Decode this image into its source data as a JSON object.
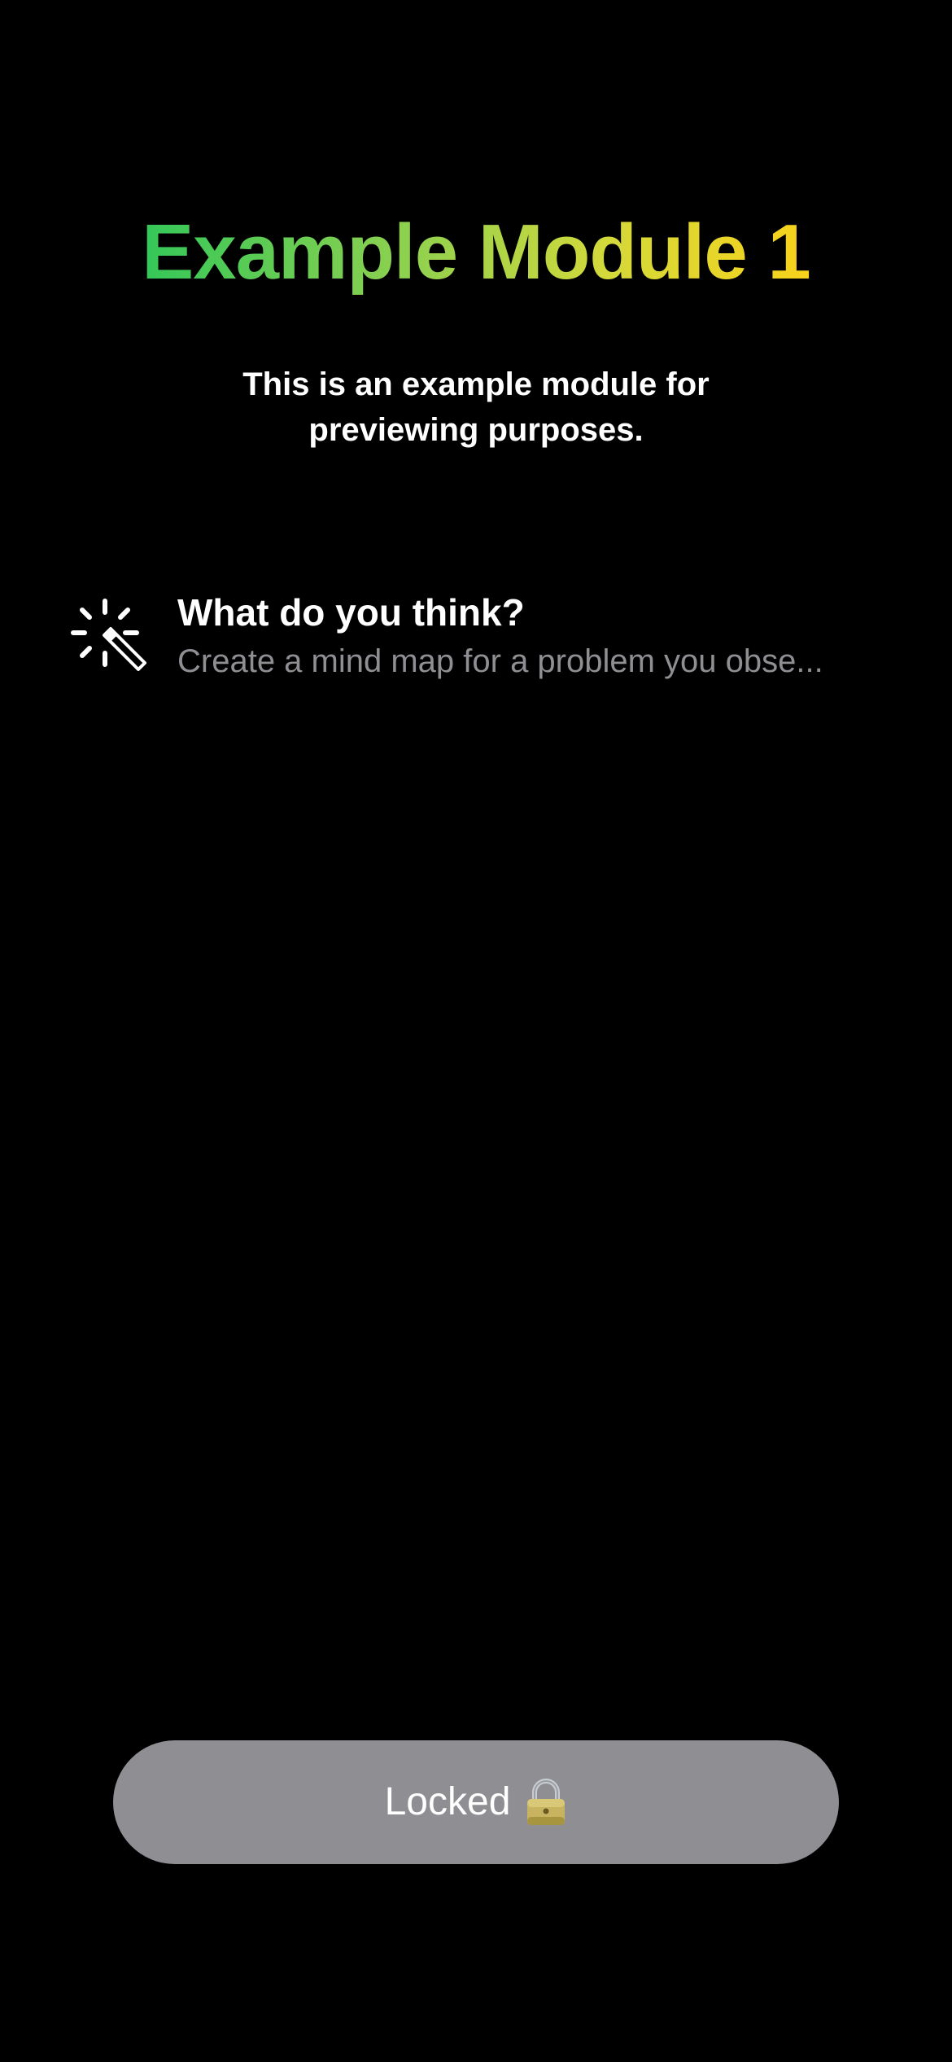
{
  "module": {
    "title": "Example Module 1",
    "description": "This is an example module for previewing purposes.",
    "title_gradient": [
      "#34c759",
      "#8fd14f",
      "#d4d93a",
      "#f7d21b"
    ]
  },
  "activities": [
    {
      "icon": "magic-wand-icon",
      "title": "What do you think?",
      "description": "Create a mind map for a problem you obse..."
    }
  ],
  "footer": {
    "button_label": "Locked",
    "button_icon": "lock-icon",
    "button_color": "#8e8e93"
  }
}
